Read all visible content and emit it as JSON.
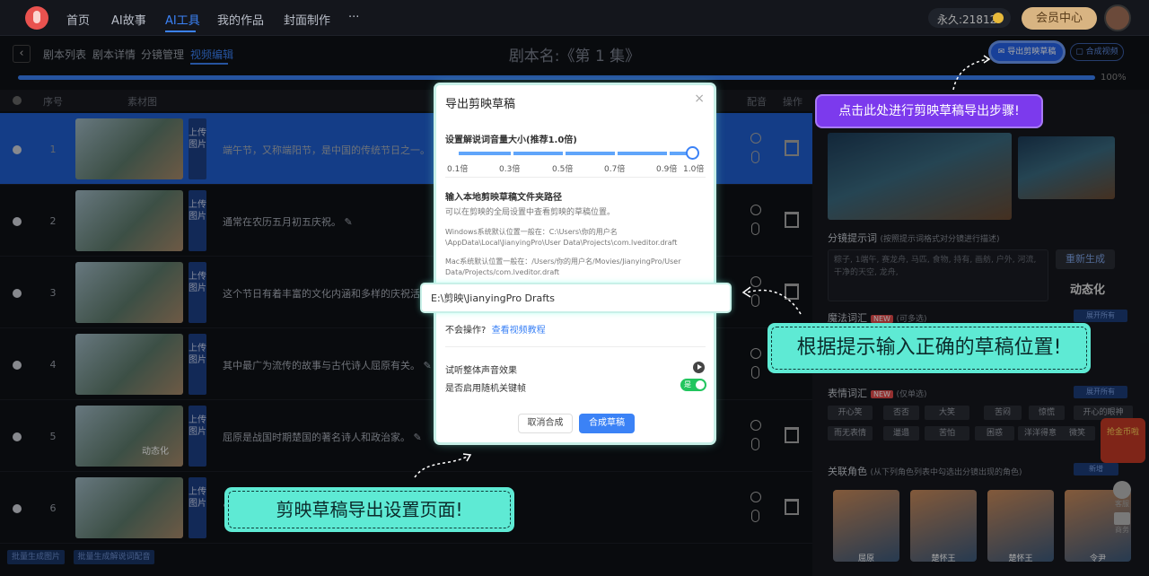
{
  "topnav": {
    "items": [
      "首页",
      "AI故事",
      "AI工具",
      "我的作品",
      "封面制作",
      "···"
    ],
    "active_index": 2,
    "coins": "永久:21812",
    "vip_label": "会员中心"
  },
  "subnav": {
    "back_icon": "chevron-left-icon",
    "tabs": [
      "剧本列表",
      "剧本详情",
      "分镜管理",
      "视频编辑"
    ],
    "active_index": 3,
    "title": "剧本名:《第 1 集》",
    "export_label": "导出剪映草稿",
    "compose_label": "合成视频",
    "progress_percent": 100,
    "progress_label": "100%"
  },
  "table": {
    "headers": [
      "序号",
      "素材图",
      "配音",
      "操作"
    ],
    "upload_label": "上传图片",
    "rows": [
      {
        "num": "1",
        "text": "端午节，又称端阳节，是中国的传统节日之一。",
        "selected": true
      },
      {
        "num": "2",
        "text": "通常在农历五月初五庆祝。",
        "selected": false
      },
      {
        "num": "3",
        "text": "这个节日有着丰富的文化内涵和多样的庆祝活动。",
        "selected": false
      },
      {
        "num": "4",
        "text": "其中最广为流传的故事与古代诗人屈原有关。",
        "selected": false
      },
      {
        "num": "5",
        "text": "屈原是战国时期楚国的著名诗人和政治家。",
        "selected": false
      },
      {
        "num": "6",
        "text": "",
        "selected": false
      }
    ],
    "thumb5_overlay": "动态化",
    "bottom_buttons": [
      "批量生成图片",
      "批量生成解说词配音"
    ]
  },
  "right_panel": {
    "prompt_title": "分镜提示词",
    "prompt_hint": "(按照提示词格式对分镜进行描述)",
    "prompt_text": "粽子, 1端午, 赛龙舟, 马匹, 食物, 持有, 画舫, 户外, 河流, 干净的天空, 龙舟,",
    "regen_label": "重新生成",
    "dynamic_label": "动态化",
    "magic_title": "魔法词汇",
    "magic_new": "NEW",
    "magic_hint": "(可多选)",
    "expand_label": "展开所有",
    "expr_title": "表情词汇",
    "expr_new": "NEW",
    "expr_hint": "(仅单选)",
    "expr_chips": [
      "开心笑",
      "否否",
      "大笑",
      "苦闷",
      "惊慌",
      "开心的眼神",
      "而无表情",
      "邋遢",
      "苦怕",
      "困惑",
      "洋洋得意",
      "微笑"
    ],
    "new_chip": "新增",
    "role_title": "关联角色",
    "role_hint": "(从下列角色列表中勾选出分镜出现的角色)",
    "role_names": [
      "屈原",
      "楚怀王",
      "楚怀王",
      "令尹"
    ],
    "float_badge": "抢金币啦",
    "help_labels": [
      "客服",
      "商务"
    ]
  },
  "modal": {
    "title": "导出剪映草稿",
    "close_icon": "close-icon",
    "volume_label": "设置解说词音量大小(推荐1.0倍)",
    "volume_value": 1.0,
    "ticks": [
      "0.1倍",
      "0.3倍",
      "0.5倍",
      "0.7倍",
      "0.9倍",
      "1.0倍"
    ],
    "path_label": "输入本地剪映草稿文件夹路径",
    "path_hint": "可以在剪映的全局设置中查看剪映的草稿位置。",
    "win_hint": "Windows系统默认位置一般在：C:\\Users\\你的用户名\\AppData\\Local\\JianyingPro\\User Data\\Projects\\com.lveditor.draft",
    "mac_hint": "Mac系统默认位置一般在：/Users/你的用户名/Movies/JianyingPro/User Data/Projects/com.lveditor.draft",
    "path_value": "E:\\剪映\\JianyingPro Drafts",
    "help_prefix": "不会操作?",
    "help_link": "查看视频教程",
    "listen_label": "试听整体声音效果",
    "random_label": "是否启用随机关键帧",
    "toggle_label": "是",
    "cancel_label": "取消合成",
    "ok_label": "合成草稿"
  },
  "callouts": {
    "export_tip": "点击此处进行剪映草稿导出步骤!",
    "path_tip": "根据提示输入正确的草稿位置!",
    "page_tip": "剪映草稿导出设置页面!"
  },
  "colors": {
    "accent": "#3b82f6",
    "callout_teal": "#5eead4",
    "callout_purple": "#7c3aed",
    "toggle_on": "#22c55e"
  }
}
